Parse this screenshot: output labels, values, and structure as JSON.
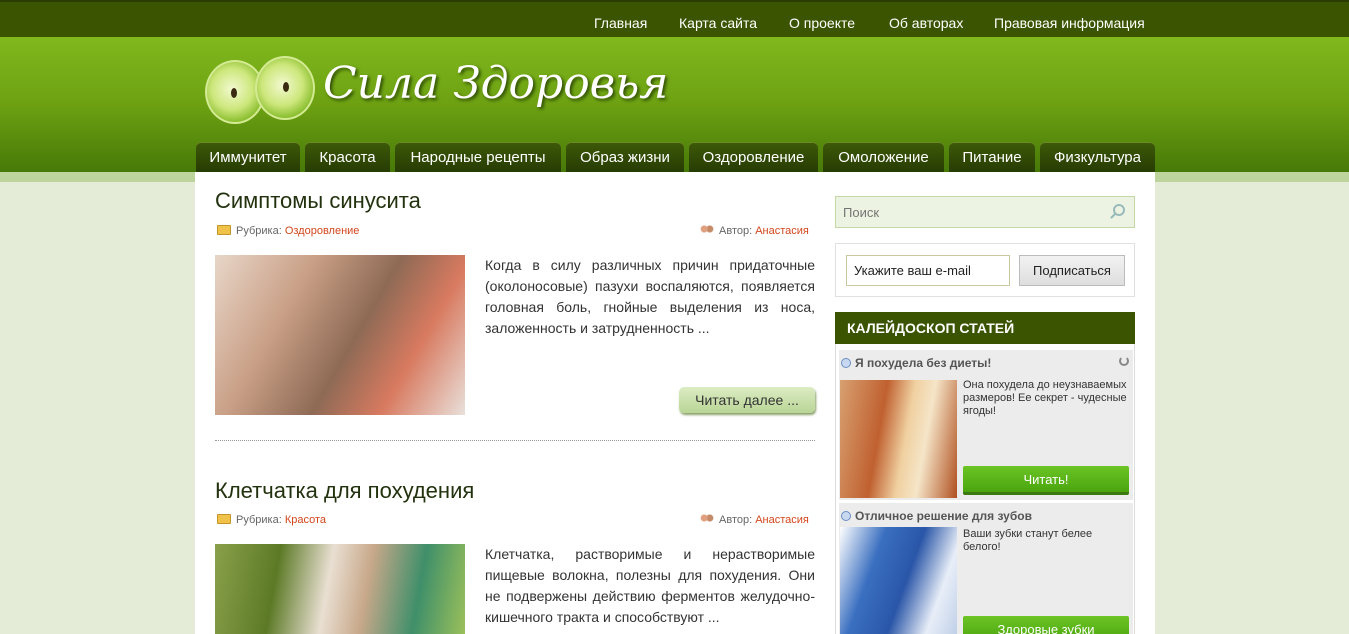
{
  "topnav": [
    "Главная",
    "Карта сайта",
    "О проекте",
    "Об авторах",
    "Правовая информация"
  ],
  "site": {
    "title": "Сила Здоровья"
  },
  "mainnav": [
    "Иммунитет",
    "Красота",
    "Народные рецепты",
    "Образ жизни",
    "Оздоровление",
    "Омоложение",
    "Питание",
    "Физкультура"
  ],
  "posts": [
    {
      "title": "Симптомы синусита",
      "category_label": "Рубрика:",
      "category": "Оздоровление",
      "author_label": "Автор:",
      "author": "Анастасия",
      "excerpt": "Когда в силу различных причин придаточные (околоносовые) пазухи воспаляются, появляется головная боль, гнойные выделения из носа, заложенность и затрудненность ...",
      "read_more": "Читать далее ..."
    },
    {
      "title": "Клетчатка для похудения",
      "category_label": "Рубрика:",
      "category": "Красота",
      "author_label": "Автор:",
      "author": "Анастасия",
      "excerpt": "Клетчатка, растворимые и нерастворимые пищевые волокна, полезны для похудения. Они не подвержены действию ферментов желудочно-кишечного тракта и способствуют ..."
    }
  ],
  "sidebar": {
    "search_placeholder": "Поиск",
    "email_value": "Укажите ваш e-mail",
    "subscribe_label": "Подписаться",
    "kaleido_title": "КАЛЕЙДОСКОП СТАТЕЙ",
    "ads": [
      {
        "title": "Я похудела без диеты!",
        "text": "Она похудела до неузнаваемых размеров! Ее секрет - чудесные ягоды!",
        "button": "Читать!"
      },
      {
        "title": "Отличное решение для зубов",
        "text": "Ваши зубки станут белее белого!",
        "button": "Здоровые зубки"
      }
    ]
  },
  "colors": {
    "topbar": "#3b5402",
    "header": "#6da112",
    "accent_link": "#d2461c",
    "ad_button": "#57b215"
  }
}
